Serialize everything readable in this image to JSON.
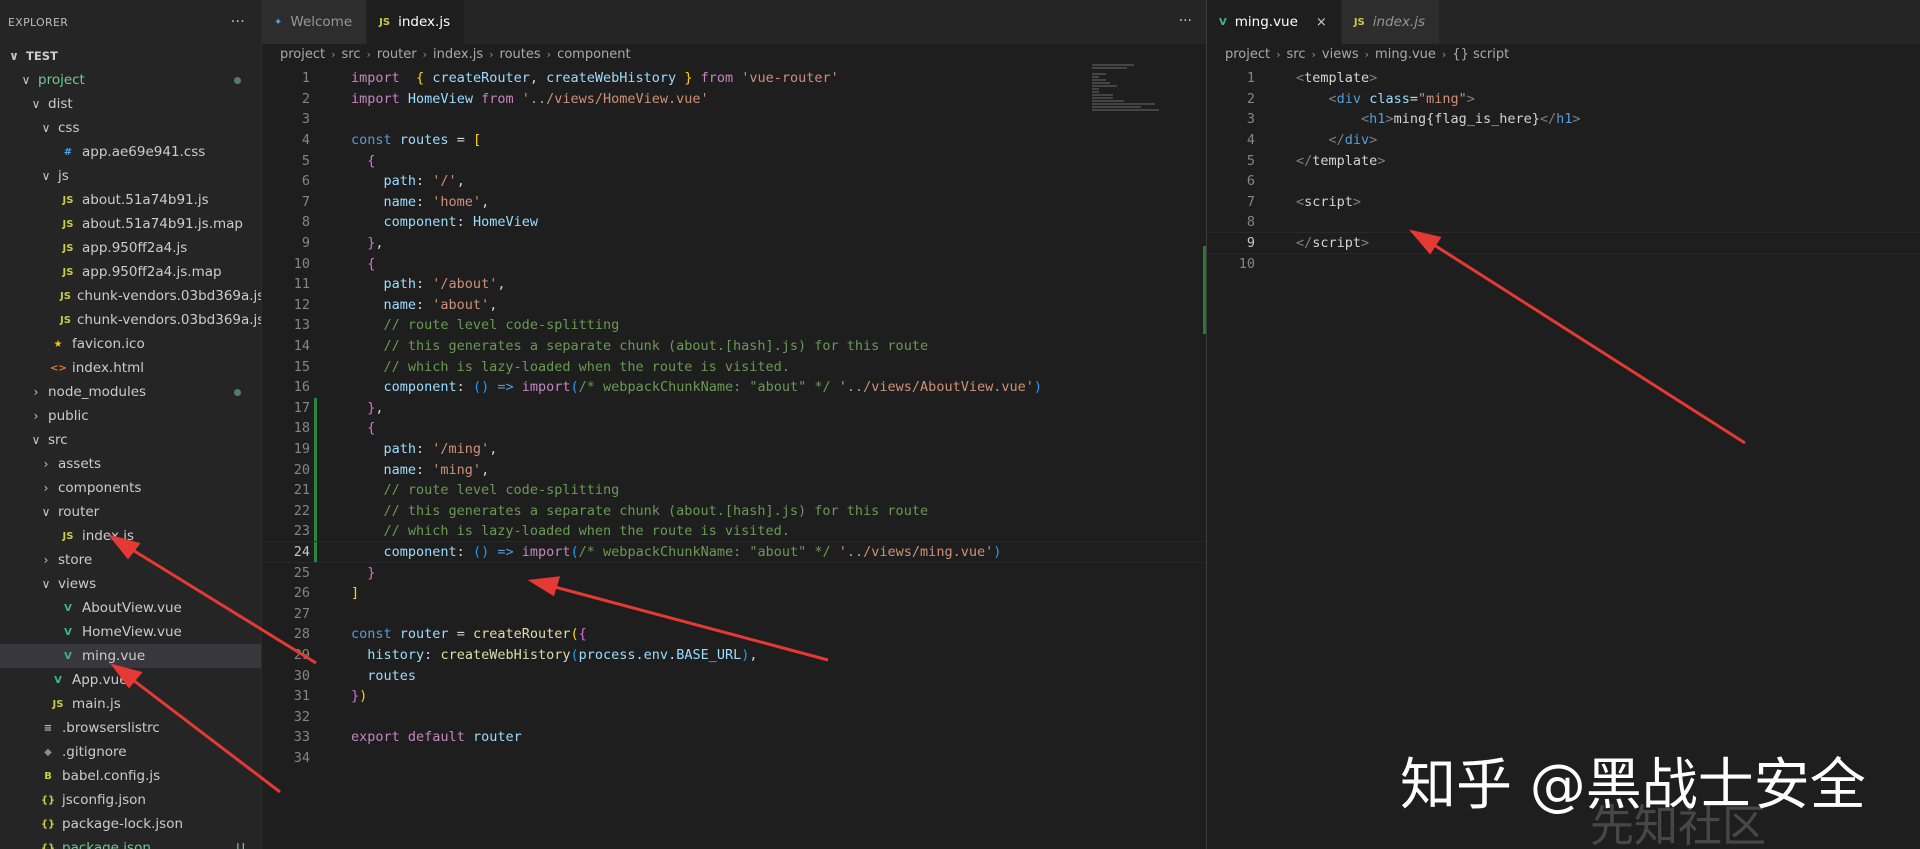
{
  "sidebar": {
    "header": "EXPLORER",
    "more": "···",
    "items": [
      {
        "label": "TEST",
        "depth": 0,
        "kind": "root",
        "chev": "∨"
      },
      {
        "label": "project",
        "depth": 1,
        "kind": "folder",
        "chev": "∨",
        "green": true,
        "dot": true
      },
      {
        "label": "dist",
        "depth": 2,
        "kind": "folder",
        "chev": "∨"
      },
      {
        "label": "css",
        "depth": 3,
        "kind": "folder",
        "chev": "∨"
      },
      {
        "label": "app.ae69e941.css",
        "depth": 4,
        "kind": "css",
        "icon": "#"
      },
      {
        "label": "js",
        "depth": 3,
        "kind": "folder",
        "chev": "∨"
      },
      {
        "label": "about.51a74b91.js",
        "depth": 4,
        "kind": "js",
        "icon": "JS"
      },
      {
        "label": "about.51a74b91.js.map",
        "depth": 4,
        "kind": "js",
        "icon": "JS"
      },
      {
        "label": "app.950ff2a4.js",
        "depth": 4,
        "kind": "js",
        "icon": "JS"
      },
      {
        "label": "app.950ff2a4.js.map",
        "depth": 4,
        "kind": "js",
        "icon": "JS"
      },
      {
        "label": "chunk-vendors.03bd369a.js",
        "depth": 4,
        "kind": "js",
        "icon": "JS"
      },
      {
        "label": "chunk-vendors.03bd369a.js.map",
        "depth": 4,
        "kind": "js",
        "icon": "JS"
      },
      {
        "label": "favicon.ico",
        "depth": 3,
        "kind": "ico",
        "icon": "★"
      },
      {
        "label": "index.html",
        "depth": 3,
        "kind": "html",
        "icon": "<>"
      },
      {
        "label": "node_modules",
        "depth": 2,
        "kind": "folder",
        "chev": "›",
        "dot": true
      },
      {
        "label": "public",
        "depth": 2,
        "kind": "folder",
        "chev": "›"
      },
      {
        "label": "src",
        "depth": 2,
        "kind": "folder",
        "chev": "∨"
      },
      {
        "label": "assets",
        "depth": 3,
        "kind": "folder",
        "chev": "›"
      },
      {
        "label": "components",
        "depth": 3,
        "kind": "folder",
        "chev": "›"
      },
      {
        "label": "router",
        "depth": 3,
        "kind": "folder",
        "chev": "∨"
      },
      {
        "label": "index.js",
        "depth": 4,
        "kind": "js",
        "icon": "JS"
      },
      {
        "label": "store",
        "depth": 3,
        "kind": "folder",
        "chev": "›"
      },
      {
        "label": "views",
        "depth": 3,
        "kind": "folder",
        "chev": "∨"
      },
      {
        "label": "AboutView.vue",
        "depth": 4,
        "kind": "vue",
        "icon": "V"
      },
      {
        "label": "HomeView.vue",
        "depth": 4,
        "kind": "vue",
        "icon": "V"
      },
      {
        "label": "ming.vue",
        "depth": 4,
        "kind": "vue",
        "icon": "V",
        "selected": true
      },
      {
        "label": "App.vue",
        "depth": 3,
        "kind": "vue",
        "icon": "V"
      },
      {
        "label": "main.js",
        "depth": 3,
        "kind": "js",
        "icon": "JS"
      },
      {
        "label": ".browserslistrc",
        "depth": 2,
        "kind": "browsers",
        "icon": "≡"
      },
      {
        "label": ".gitignore",
        "depth": 2,
        "kind": "git",
        "icon": "◆"
      },
      {
        "label": "babel.config.js",
        "depth": 2,
        "kind": "json",
        "icon": "B"
      },
      {
        "label": "jsconfig.json",
        "depth": 2,
        "kind": "json",
        "icon": "{}"
      },
      {
        "label": "package-lock.json",
        "depth": 2,
        "kind": "json",
        "icon": "{}"
      },
      {
        "label": "package.json",
        "depth": 2,
        "kind": "json",
        "icon": "{}",
        "green": true,
        "badge": "U"
      }
    ]
  },
  "left_editor": {
    "tabs": [
      {
        "label": "Welcome",
        "icon": "✦",
        "active": false
      },
      {
        "label": "index.js",
        "icon": "JS",
        "active": true
      }
    ],
    "more": "···",
    "breadcrumb": [
      "project",
      "src",
      "router",
      "index.js",
      "routes",
      "component"
    ],
    "current_line": 24,
    "lines": [
      [
        [
          "kw",
          "import"
        ],
        [
          "",
          "  "
        ],
        [
          "br1",
          "{"
        ],
        [
          "",
          " "
        ],
        [
          "var",
          "createRouter"
        ],
        [
          "",
          ", "
        ],
        [
          "var",
          "createWebHistory"
        ],
        [
          "",
          " "
        ],
        [
          "br1",
          "}"
        ],
        [
          "",
          " "
        ],
        [
          "kw",
          "from"
        ],
        [
          "",
          " "
        ],
        [
          "str",
          "'vue-router'"
        ]
      ],
      [
        [
          "kw",
          "import"
        ],
        [
          "",
          " "
        ],
        [
          "var",
          "HomeView"
        ],
        [
          "",
          " "
        ],
        [
          "kw",
          "from"
        ],
        [
          "",
          " "
        ],
        [
          "str",
          "'../views/HomeView.vue'"
        ]
      ],
      [],
      [
        [
          "kw2",
          "const"
        ],
        [
          "",
          " "
        ],
        [
          "var",
          "routes"
        ],
        [
          "",
          " = "
        ],
        [
          "br1",
          "["
        ]
      ],
      [
        [
          "",
          "  "
        ],
        [
          "br2",
          "{"
        ]
      ],
      [
        [
          "",
          "    "
        ],
        [
          "var",
          "path"
        ],
        [
          "",
          ": "
        ],
        [
          "str",
          "'/'"
        ],
        [
          "",
          ","
        ]
      ],
      [
        [
          "",
          "    "
        ],
        [
          "var",
          "name"
        ],
        [
          "",
          ": "
        ],
        [
          "str",
          "'home'"
        ],
        [
          "",
          ","
        ]
      ],
      [
        [
          "",
          "    "
        ],
        [
          "var",
          "component"
        ],
        [
          "",
          ": "
        ],
        [
          "var",
          "HomeView"
        ]
      ],
      [
        [
          "",
          "  "
        ],
        [
          "br2",
          "}"
        ],
        [
          "",
          ","
        ]
      ],
      [
        [
          "",
          "  "
        ],
        [
          "br2",
          "{"
        ]
      ],
      [
        [
          "",
          "    "
        ],
        [
          "var",
          "path"
        ],
        [
          "",
          ": "
        ],
        [
          "str",
          "'/about'"
        ],
        [
          "",
          ","
        ]
      ],
      [
        [
          "",
          "    "
        ],
        [
          "var",
          "name"
        ],
        [
          "",
          ": "
        ],
        [
          "str",
          "'about'"
        ],
        [
          "",
          ","
        ]
      ],
      [
        [
          "",
          "    "
        ],
        [
          "com",
          "// route level code-splitting"
        ]
      ],
      [
        [
          "",
          "    "
        ],
        [
          "com",
          "// this generates a separate chunk (about.[hash].js) for this route"
        ]
      ],
      [
        [
          "",
          "    "
        ],
        [
          "com",
          "// which is lazy-loaded when the route is visited."
        ]
      ],
      [
        [
          "",
          "    "
        ],
        [
          "var",
          "component"
        ],
        [
          "",
          ": "
        ],
        [
          "br3",
          "()"
        ],
        [
          "",
          " "
        ],
        [
          "kw2",
          "=>"
        ],
        [
          "",
          " "
        ],
        [
          "kw",
          "import"
        ],
        [
          "br3",
          "("
        ],
        [
          "com",
          "/* webpackChunkName: \"about\" */"
        ],
        [
          "",
          " "
        ],
        [
          "str",
          "'../views/AboutView.vue'"
        ],
        [
          "br3",
          ")"
        ]
      ],
      [
        [
          "",
          "  "
        ],
        [
          "br2",
          "}"
        ],
        [
          "",
          ","
        ]
      ],
      [
        [
          "",
          "  "
        ],
        [
          "br2",
          "{"
        ]
      ],
      [
        [
          "",
          "    "
        ],
        [
          "var",
          "path"
        ],
        [
          "",
          ": "
        ],
        [
          "str",
          "'/ming'"
        ],
        [
          "",
          ","
        ]
      ],
      [
        [
          "",
          "    "
        ],
        [
          "var",
          "name"
        ],
        [
          "",
          ": "
        ],
        [
          "str",
          "'ming'"
        ],
        [
          "",
          ","
        ]
      ],
      [
        [
          "",
          "    "
        ],
        [
          "com",
          "// route level code-splitting"
        ]
      ],
      [
        [
          "",
          "    "
        ],
        [
          "com",
          "// this generates a separate chunk (about.[hash].js) for this route"
        ]
      ],
      [
        [
          "",
          "    "
        ],
        [
          "com",
          "// which is lazy-loaded when the route is visited."
        ]
      ],
      [
        [
          "",
          "    "
        ],
        [
          "var",
          "component"
        ],
        [
          "",
          ": "
        ],
        [
          "br3",
          "()"
        ],
        [
          "",
          " "
        ],
        [
          "kw2",
          "=>"
        ],
        [
          "",
          " "
        ],
        [
          "kw",
          "import"
        ],
        [
          "br3",
          "("
        ],
        [
          "com",
          "/* webpackChunkName: \"about\" */"
        ],
        [
          "",
          " "
        ],
        [
          "str",
          "'../views/ming.vue'"
        ],
        [
          "br3",
          ")"
        ]
      ],
      [
        [
          "",
          "  "
        ],
        [
          "br2",
          "}"
        ]
      ],
      [
        [
          "br1",
          "]"
        ]
      ],
      [],
      [
        [
          "kw2",
          "const"
        ],
        [
          "",
          " "
        ],
        [
          "var",
          "router"
        ],
        [
          "",
          " = "
        ],
        [
          "fn",
          "createRouter"
        ],
        [
          "br1",
          "("
        ],
        [
          "br2",
          "{"
        ]
      ],
      [
        [
          "",
          "  "
        ],
        [
          "var",
          "history"
        ],
        [
          "",
          ": "
        ],
        [
          "fn",
          "createWebHistory"
        ],
        [
          "br3",
          "("
        ],
        [
          "var",
          "process"
        ],
        [
          "",
          "."
        ],
        [
          "var",
          "env"
        ],
        [
          "",
          "."
        ],
        [
          "var",
          "BASE_URL"
        ],
        [
          "br3",
          ")"
        ],
        [
          "",
          ","
        ]
      ],
      [
        [
          "",
          "  "
        ],
        [
          "var",
          "routes"
        ]
      ],
      [
        [
          "br2",
          "}"
        ],
        [
          "br1",
          ")"
        ]
      ],
      [],
      [
        [
          "kw",
          "export"
        ],
        [
          "",
          " "
        ],
        [
          "kw",
          "default"
        ],
        [
          "",
          " "
        ],
        [
          "var",
          "router"
        ]
      ],
      []
    ],
    "modified_lines": [
      17,
      18,
      19,
      20,
      21,
      22,
      23,
      24
    ]
  },
  "right_editor": {
    "tabs": [
      {
        "label": "ming.vue",
        "icon": "V",
        "active": true,
        "close": "×"
      },
      {
        "label": "index.js",
        "icon": "JS",
        "active": false,
        "italic": true
      }
    ],
    "breadcrumb": [
      "project",
      "src",
      "views",
      "ming.vue",
      "{} script"
    ],
    "current_line": 9,
    "lines": [
      [
        [
          "tagb",
          "<"
        ],
        [
          "",
          "template"
        ],
        [
          "tagb",
          ">"
        ]
      ],
      [
        [
          "",
          "    "
        ],
        [
          "tagb",
          "<"
        ],
        [
          "tagn",
          "div"
        ],
        [
          "",
          " "
        ],
        [
          "attr",
          "class"
        ],
        [
          "",
          "="
        ],
        [
          "str",
          "\"ming\""
        ],
        [
          "tagb",
          ">"
        ]
      ],
      [
        [
          "",
          "        "
        ],
        [
          "tagb",
          "<"
        ],
        [
          "tagn",
          "h1"
        ],
        [
          "tagb",
          ">"
        ],
        [
          "",
          "ming{flag_is_here}"
        ],
        [
          "tagb",
          "</"
        ],
        [
          "tagn",
          "h1"
        ],
        [
          "tagb",
          ">"
        ]
      ],
      [
        [
          "",
          "    "
        ],
        [
          "tagb",
          "</"
        ],
        [
          "tagn",
          "div"
        ],
        [
          "tagb",
          ">"
        ]
      ],
      [
        [
          "tagb",
          "</"
        ],
        [
          "",
          "template"
        ],
        [
          "tagb",
          ">"
        ]
      ],
      [],
      [
        [
          "tagb",
          "<"
        ],
        [
          "",
          "script"
        ],
        [
          "tagb",
          ">"
        ]
      ],
      [],
      [
        [
          "tagb",
          "</"
        ],
        [
          "",
          "script"
        ],
        [
          "tagb",
          ">"
        ]
      ],
      []
    ]
  },
  "watermark": {
    "primary": "知乎 @黑战士安全",
    "secondary": "先知社区"
  },
  "colors": {
    "accent_annotation": "#e53935",
    "git_added": "#2ea043",
    "vue_green": "#41b883",
    "js_yellow": "#cbcb41"
  }
}
